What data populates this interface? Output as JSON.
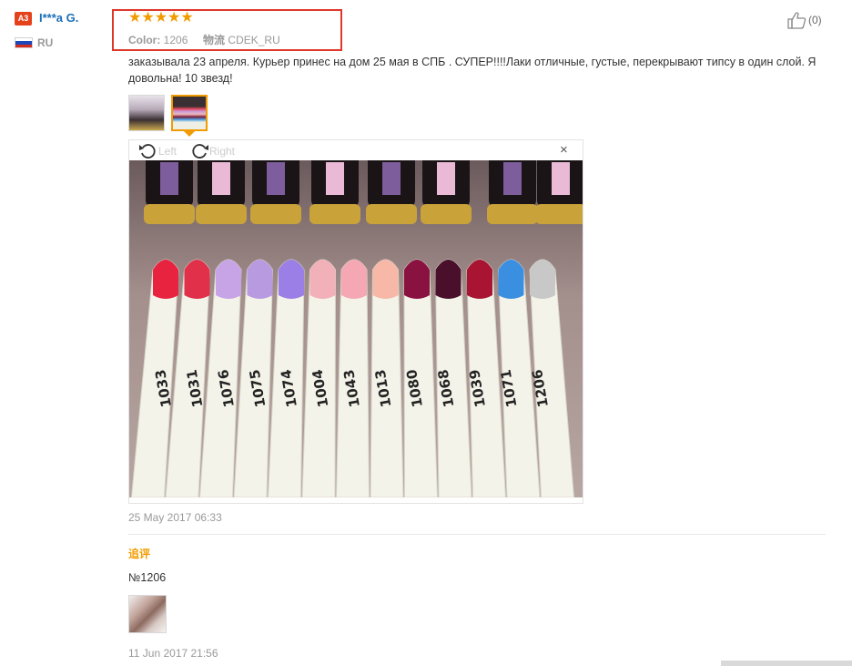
{
  "user": {
    "badge": "A3",
    "name": "I***a G.",
    "country": "RU",
    "flag_colors": [
      "#ffffff",
      "#1c47b8",
      "#d52b1e"
    ]
  },
  "rating": {
    "stars": "★★★★★",
    "star_count": 5,
    "star_color": "#f29b00"
  },
  "attributes": {
    "color_label": "Color:",
    "color_value": "1206",
    "logistics_label": "物流",
    "logistics_value": "CDEK_RU"
  },
  "helpful": {
    "count": "(0)",
    "icon": "thumbs-up-icon"
  },
  "review": {
    "text": "заказывала 23 апреля. Курьер принес на дом 25 мая в СПБ . СУПЕР!!!!Лаки отличные, густые, перекрывают типсу в один слой. Я довольна! 10 звезд!",
    "date": "25 May 2017 06:33"
  },
  "viewer": {
    "rotate_left": "Left",
    "rotate_right": "Right",
    "close": "×",
    "swatch_labels": [
      "1033",
      "1031",
      "1076",
      "1075",
      "1074",
      "1004",
      "1043",
      "1013",
      "1080",
      "1068",
      "1039",
      "1071",
      "1206"
    ],
    "swatch_colors": [
      "#e8233f",
      "#e0304a",
      "#c7a4e6",
      "#b89ae0",
      "#9b7ee6",
      "#f2b0b8",
      "#f5a8b4",
      "#f7b8a8",
      "#8a1240",
      "#4a0f2a",
      "#a81432",
      "#3a8fe0",
      "#c8c8c8"
    ]
  },
  "follow_up": {
    "label": "追评",
    "text": "№1206",
    "date": "11 Jun 2017 21:56"
  },
  "colors": {
    "accent": "#f29b00",
    "highlight_box": "#e0372b",
    "user_link": "#1d6fb8",
    "badge_bg": "#e5421c"
  }
}
